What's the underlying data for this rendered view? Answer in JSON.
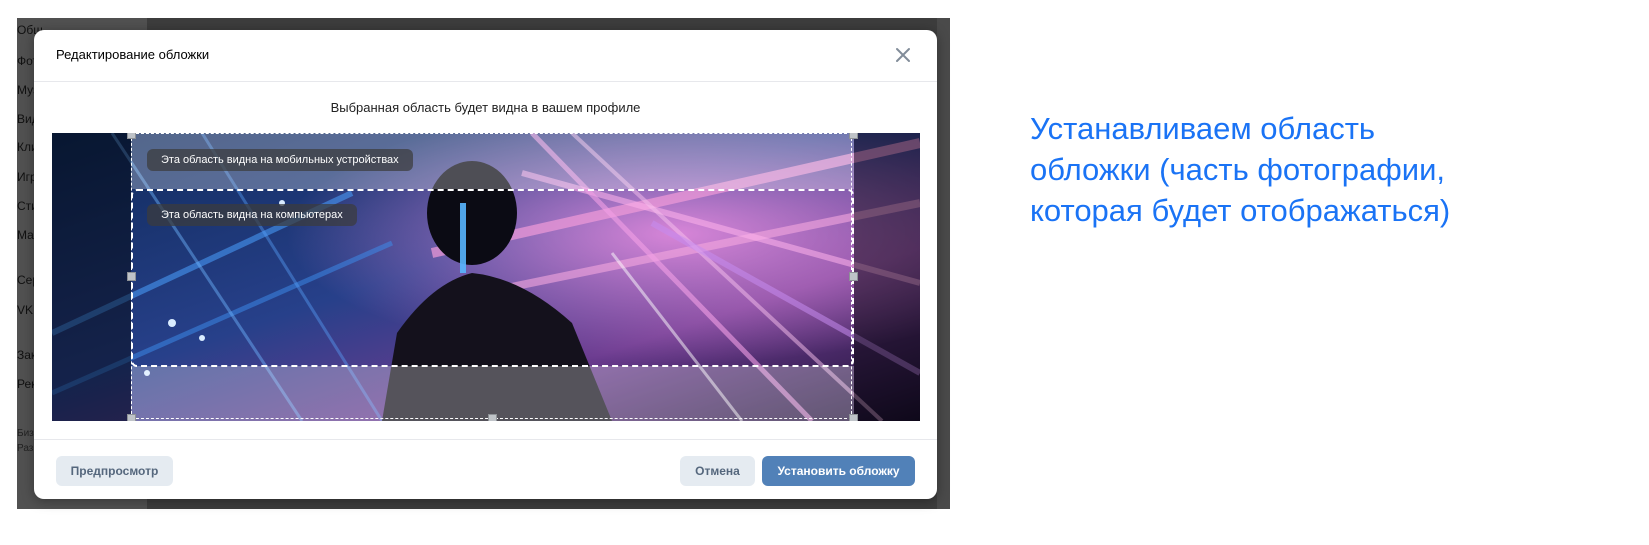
{
  "background_page": {
    "sidebar_fragments": [
      "Общ",
      "Фотогр",
      "Музык",
      "Видео",
      "Клипы",
      "Игры",
      "Стикер",
      "Маркет",
      "Сервис",
      "VK Pay",
      "Закладк",
      "Реклам",
      "Бизнес",
      "Разработ"
    ]
  },
  "modal": {
    "title": "Редактирование обложки",
    "close_icon": "close-icon",
    "hint": "Выбранная область будет видна в вашем профиле",
    "crop": {
      "mobile_label": "Эта область видна на мобильных устройствах",
      "desktop_label": "Эта область видна на компьютерах"
    },
    "footer": {
      "preview_label": "Предпросмотр",
      "cancel_label": "Отмена",
      "submit_label": "Установить обложку"
    }
  },
  "caption": {
    "line1": "Устанавливаем область",
    "line2": "обложки (часть фотографии,",
    "line3": "которая будет отображаться)"
  },
  "colors": {
    "accent": "#5181b8",
    "secondary_button_bg": "#e5ebf1",
    "secondary_button_text": "#55677d",
    "caption_text": "#1a73f5"
  }
}
